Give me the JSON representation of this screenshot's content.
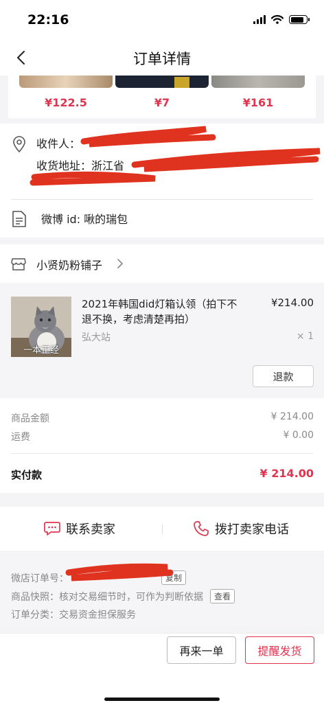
{
  "status_bar": {
    "time": "22:16",
    "battery_level": 0.85
  },
  "nav": {
    "title": "订单详情"
  },
  "products_strip": {
    "prices": [
      "¥122.5",
      "¥7",
      "¥161"
    ]
  },
  "address": {
    "recipient_label": "收件人：",
    "address_label": "收货地址：浙江省",
    "weibo_id": "微博 id: 啾的瑞包"
  },
  "shop": {
    "name": "小贤奶粉铺子"
  },
  "item": {
    "title": "2021年韩国did灯箱认领（拍下不退不换，考虑清楚再拍）",
    "spec": "弘大站",
    "price": "¥214.00",
    "quantity": "× 1",
    "image_caption": "一本正经",
    "refund_label": "退款"
  },
  "totals": {
    "goods_label": "商品金额",
    "goods_value": "¥ 214.00",
    "shipping_label": "运费",
    "shipping_value": "¥ 0.00",
    "paid_label": "实付款",
    "paid_value": "¥ 214.00"
  },
  "contact": {
    "chat_label": "联系卖家",
    "call_label": "拨打卖家电话"
  },
  "order_info": {
    "order_no_label": "微店订单号：",
    "copy_label": "复制",
    "snapshot_text": "商品快照：核对交易细节时，可作为判断依据",
    "view_label": "查看",
    "category_text": "订单分类：交易资金担保服务"
  },
  "footer": {
    "buy_again_label": "再来一单",
    "remind_label": "提醒发货"
  },
  "colors": {
    "accent": "#e0334d",
    "redaction": "#e0331f"
  }
}
